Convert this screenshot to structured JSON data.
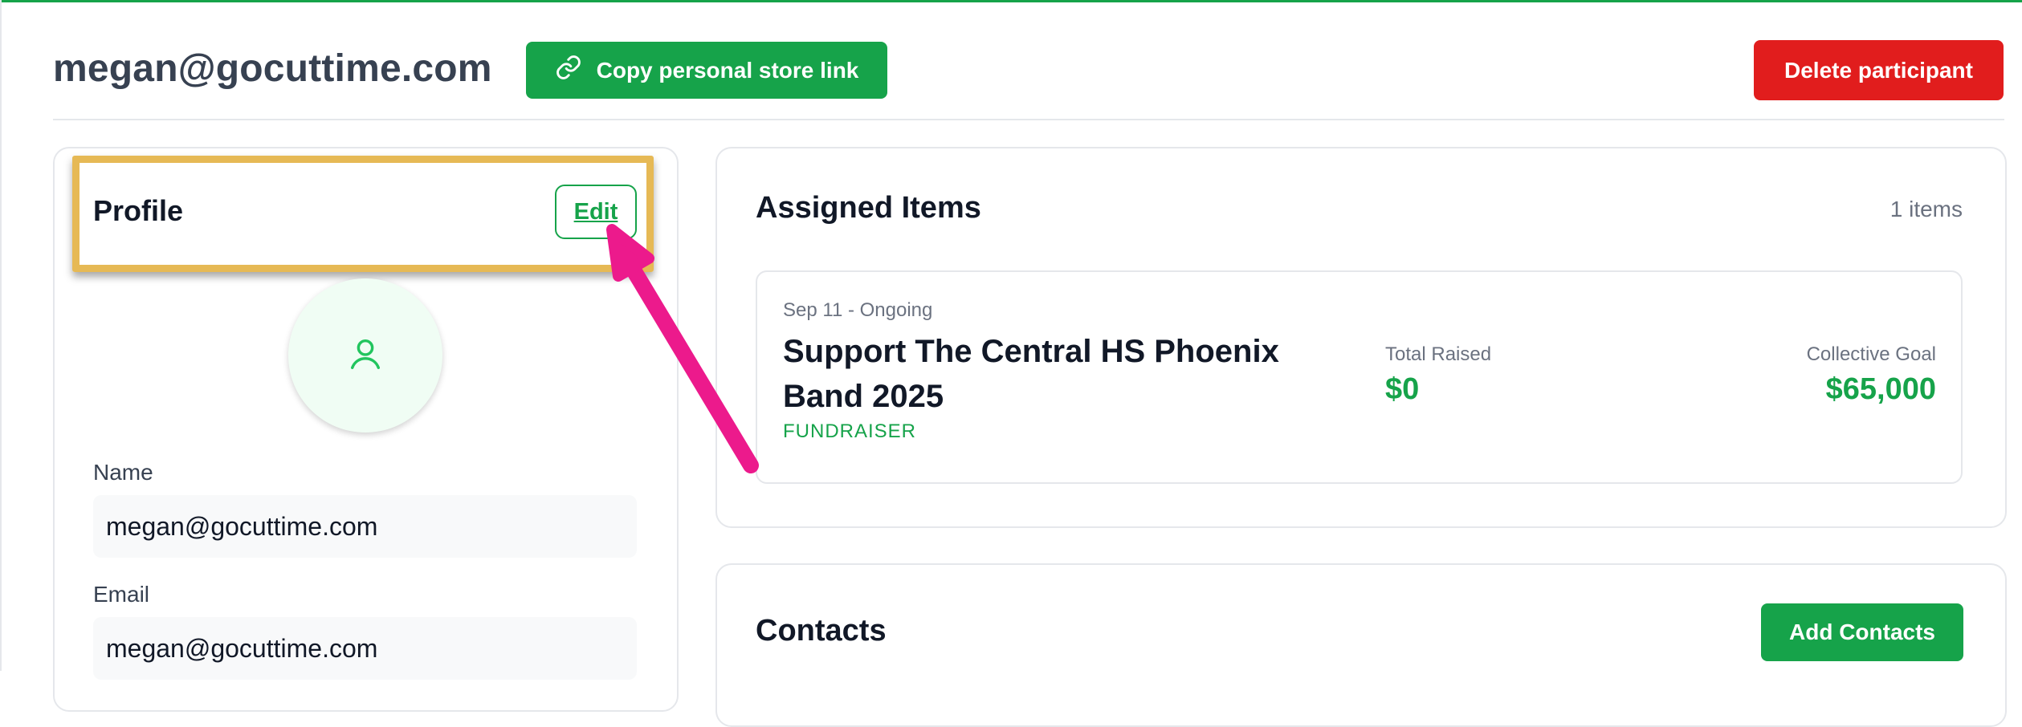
{
  "header": {
    "title": "megan@gocuttime.com",
    "copy_link_label": "Copy personal store link",
    "delete_label": "Delete participant"
  },
  "profile": {
    "title": "Profile",
    "edit_label": "Edit",
    "avatar_icon": "user-icon",
    "fields": [
      {
        "label": "Name",
        "value": "megan@gocuttime.com"
      },
      {
        "label": "Email",
        "value": "megan@gocuttime.com"
      }
    ]
  },
  "assigned_items": {
    "title": "Assigned Items",
    "count_label": "1 items",
    "items": [
      {
        "date_range": "Sep 11 - Ongoing",
        "name": "Support The Central HS Phoenix Band 2025",
        "type": "FUNDRAISER",
        "raised_label": "Total Raised",
        "raised_value": "$0",
        "goal_label": "Collective Goal",
        "goal_value": "$65,000"
      }
    ]
  },
  "contacts": {
    "title": "Contacts",
    "add_label": "Add Contacts"
  },
  "colors": {
    "accent_green": "#16a34a",
    "danger_red": "#e11d1d",
    "highlight_gold": "#e6b955",
    "annotation_pink": "#ec1a8c"
  },
  "annotation": {
    "highlight_target": "profile-header",
    "arrow_points_to": "edit-button"
  }
}
